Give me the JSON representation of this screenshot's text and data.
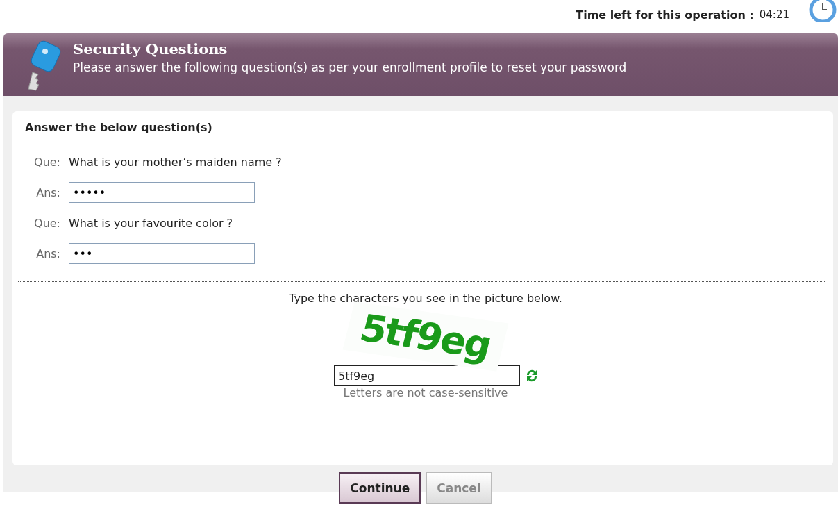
{
  "timer": {
    "label": "Time left for this operation :",
    "value": "04:21"
  },
  "header": {
    "title": "Security Questions",
    "subtitle": "Please answer the following question(s) as per your enrollment profile to reset your password"
  },
  "questions_section": {
    "heading": "Answer the below question(s)",
    "items": [
      {
        "question_label": "Que:",
        "question": "What is your mother’s maiden name ?",
        "answer_label": "Ans:",
        "answer": "•••••"
      },
      {
        "question_label": "Que:",
        "question": "What is your favourite color ?",
        "answer_label": "Ans:",
        "answer": "•••"
      }
    ]
  },
  "captcha": {
    "instruction": "Type the characters you see in the picture below.",
    "image_text": "5tf9eg",
    "value": "5tf9eg",
    "hint": "Letters are not case-sensitive"
  },
  "buttons": [
    {
      "label": "Continue",
      "kind": "primary",
      "disabled": false
    },
    {
      "label": "Cancel",
      "kind": "secondary",
      "disabled": true
    }
  ]
}
